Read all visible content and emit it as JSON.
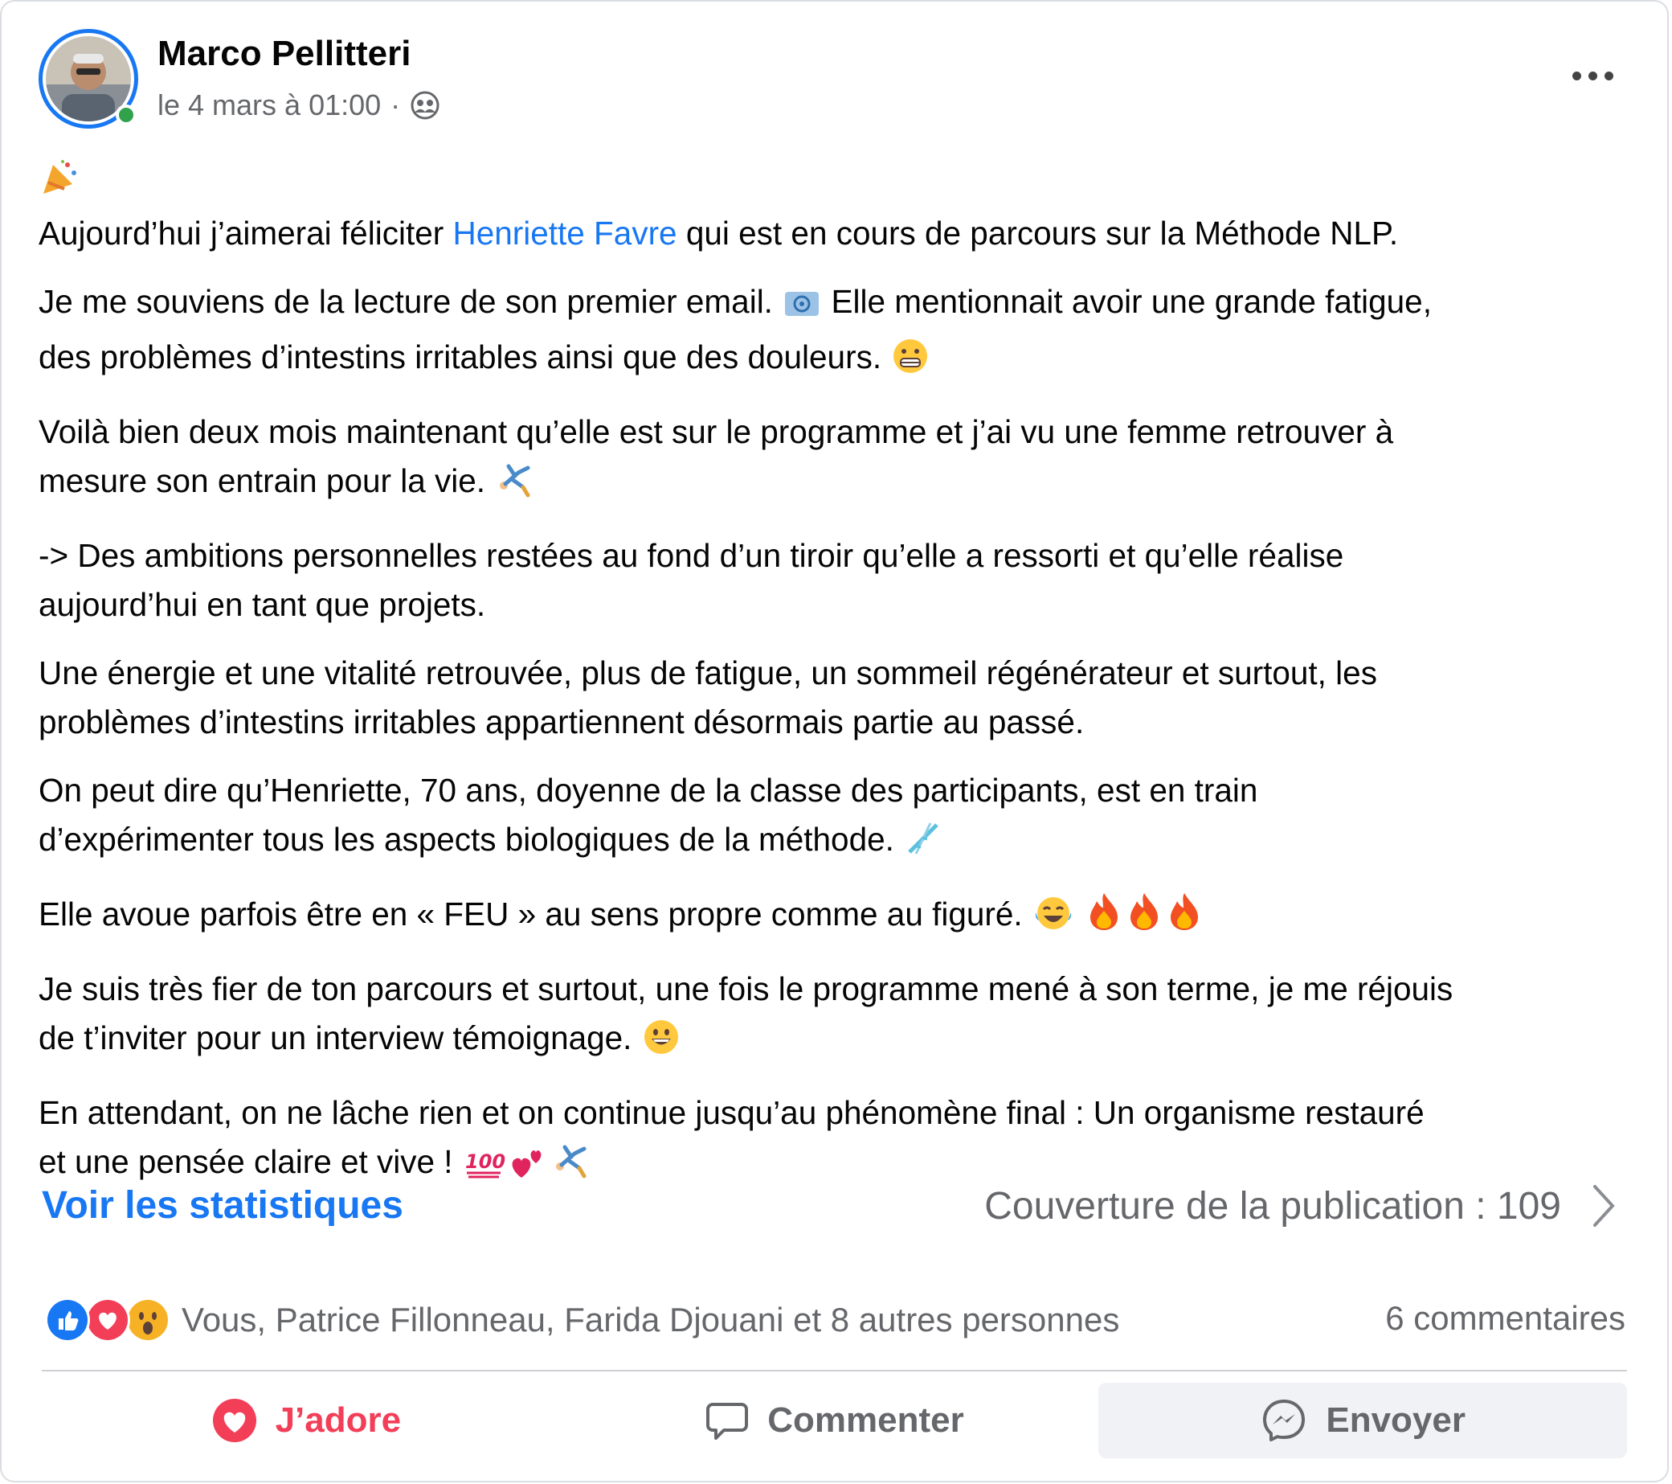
{
  "post": {
    "author": "Marco Pellitteri",
    "timestamp": "le 4 mars à 01:00",
    "separator": "·",
    "privacy_icon": "friends-icon",
    "body": {
      "p1_pre": "Aujourd’hui j’aimerai féliciter ",
      "p1_mention": "Henriette Favre",
      "p1_post": " qui est en cours de parcours sur la Méthode NLP.",
      "p2_l1a": "Je me souviens de la lecture de son premier email. ",
      "p2_l1b": " Elle mentionnait avoir une grande fatigue,",
      "p2_l2": "des problèmes d’intestins irritables ainsi que des douleurs.",
      "p3_l1": "Voilà bien deux mois maintenant qu’elle est sur le programme et j’ai vu une femme retrouver à",
      "p3_l2": "mesure son entrain pour la vie.",
      "p4_l1": "-> Des ambitions personnelles restées au fond d’un tiroir qu’elle a ressorti et qu’elle réalise",
      "p4_l2": "aujourd’hui en tant que projets.",
      "p5_l1": "Une énergie et une vitalité retrouvée, plus de fatigue, un sommeil régénérateur et surtout, les",
      "p5_l2": "problèmes d’intestins irritables appartiennent désormais partie au passé.",
      "p6_l1": "On peut dire qu’Henriette, 70 ans, doyenne de la classe des participants, est en train",
      "p6_l2": "d’expérimenter tous les aspects biologiques de la méthode.",
      "p7_l1": "Elle avoue parfois être en « FEU » au sens propre comme au figuré.",
      "p8_l1": "Je suis très fier de ton parcours et surtout, une fois le programme mené à son terme, je me réjouis",
      "p8_l2": "de t’inviter pour un interview témoignage.",
      "p9_l1": "En attendant, on ne lâche rien et on continue jusqu’au phénomène final : Un organisme restauré",
      "p9_l2": "et une pensée claire et vive !"
    },
    "stats_link": "Voir les statistiques",
    "reach_text": "Couverture de la publication : 109",
    "reactions_text": "Vous, Patrice Fillonneau, Farida Djouani et 8 autres personnes",
    "comments_text": "6 commentaires",
    "actions": {
      "love": "J’adore",
      "comment": "Commenter",
      "send": "Envoyer"
    }
  },
  "colors": {
    "accent": "#1877f2",
    "love": "#f33e58",
    "muted": "#65676b",
    "online": "#31a24c"
  }
}
